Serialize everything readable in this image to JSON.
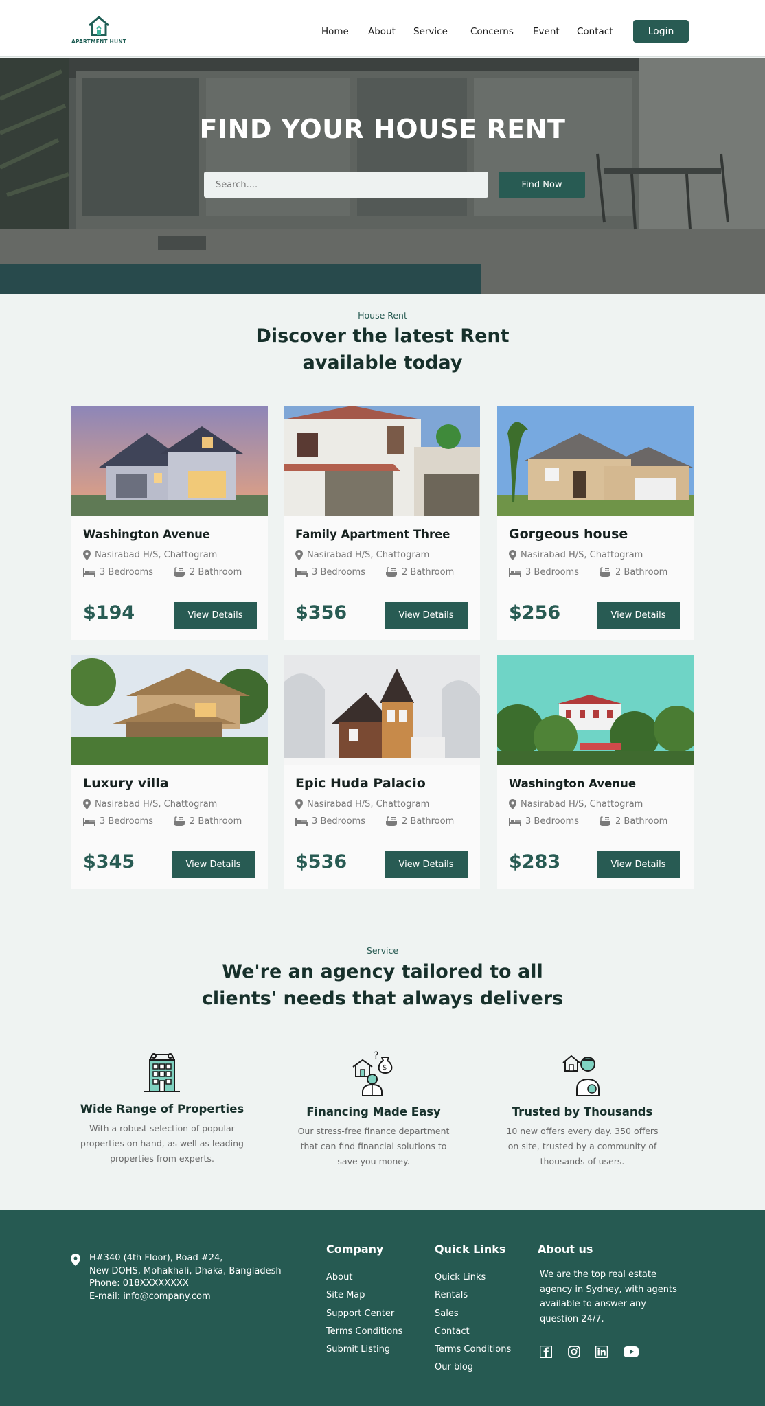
{
  "brand": {
    "name": "APARTMENT HUNT",
    "primary": "#285b53",
    "footer_bg": "#265a52",
    "page_bg": "#eff3f2"
  },
  "nav": {
    "links": [
      "Home",
      "About",
      "Service",
      "Concerns",
      "Event",
      "Contact"
    ],
    "login": "Login"
  },
  "hero": {
    "title": "FIND YOUR HOUSE RENT",
    "search_placeholder": "Search....",
    "find_button": "Find Now"
  },
  "rent_section": {
    "eyebrow": "House Rent",
    "title_line1": "Discover the latest Rent",
    "title_line2": "available today"
  },
  "listings": [
    {
      "title": "Washington Avenue",
      "location": "Nasirabad H/S, Chattogram",
      "bedrooms": "3 Bedrooms",
      "bathrooms": "2 Bathroom",
      "price": "$194",
      "button": "View Details"
    },
    {
      "title": "Family Apartment Three",
      "location": "Nasirabad H/S, Chattogram",
      "bedrooms": "3 Bedrooms",
      "bathrooms": "2 Bathroom",
      "price": "$356",
      "button": "View Details"
    },
    {
      "title": "Gorgeous house",
      "location": "Nasirabad H/S, Chattogram",
      "bedrooms": "3 Bedrooms",
      "bathrooms": "2 Bathroom",
      "price": "$256",
      "button": "View Details"
    },
    {
      "title": "Luxury villa",
      "location": "Nasirabad H/S, Chattogram",
      "bedrooms": "3 Bedrooms",
      "bathrooms": "2 Bathroom",
      "price": "$345",
      "button": "View Details"
    },
    {
      "title": "Epic Huda Palacio",
      "location": "Nasirabad H/S, Chattogram",
      "bedrooms": "3 Bedrooms",
      "bathrooms": "2 Bathroom",
      "price": "$536",
      "button": "View Details"
    },
    {
      "title": "Washington Avenue",
      "location": "Nasirabad H/S, Chattogram",
      "bedrooms": "3 Bedrooms",
      "bathrooms": "2 Bathroom",
      "price": "$283",
      "button": "View Details"
    }
  ],
  "service_section": {
    "eyebrow": "Service",
    "title_line1": "We're an agency tailored to all",
    "title_line2": "clients' needs that always delivers",
    "items": [
      {
        "icon": "building-icon",
        "title": "Wide Range of Properties",
        "desc": "With a robust selection of popular properties on hand, as well as leading properties from experts."
      },
      {
        "icon": "finance-icon",
        "title": "Financing Made Easy",
        "desc": "Our stress-free finance department that can find financial solutions to save you money."
      },
      {
        "icon": "trusted-agent-icon",
        "title": "Trusted by Thousands",
        "desc": "10 new offers every day. 350 offers on site, trusted by a community of thousands of users."
      }
    ]
  },
  "footer": {
    "address_lines": [
      "H#340 (4th Floor), Road #24,",
      "New DOHS, Mohakhali, Dhaka, Bangladesh",
      "Phone: 018XXXXXXXX",
      "E-mail: info@company.com"
    ],
    "company_title": "Company",
    "company_links": [
      "About",
      "Site Map",
      "Support Center",
      "Terms Conditions",
      "Submit Listing"
    ],
    "quick_title": "Quick Links",
    "quick_links": [
      "Quick Links",
      "Rentals",
      "Sales",
      "Contact",
      "Terms Conditions",
      "Our blog"
    ],
    "about_title": "About us",
    "about_text": "We are the top real estate agency in Sydney, with agents available to answer any question 24/7.",
    "social": [
      "facebook-icon",
      "instagram-icon",
      "linkedin-icon",
      "youtube-icon"
    ]
  }
}
